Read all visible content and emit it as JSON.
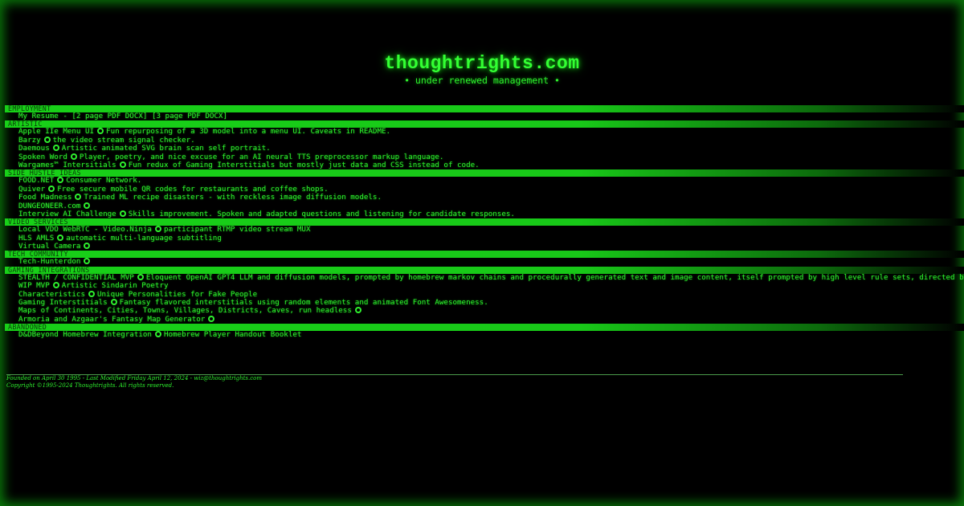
{
  "site": {
    "title": "thoughtrights.com",
    "subtitle": "• under renewed management •"
  },
  "sections": [
    {
      "title": "EMPLOYMENT",
      "items": [
        {
          "name": "My Resume - [2 page PDF DOCX] [3 page PDF DOCX]",
          "github": false,
          "desc": ""
        }
      ]
    },
    {
      "title": "ARTISTIC",
      "items": [
        {
          "name": "Apple IIe Menu UI",
          "github": true,
          "desc": "Fun repurposing of a 3D model into a menu UI. Caveats in README."
        },
        {
          "name": "Barzy",
          "github": true,
          "desc": "the video stream signal checker."
        },
        {
          "name": "Daemous",
          "github": true,
          "desc": "Artistic animated SVG brain scan self portrait."
        },
        {
          "name": "Spoken Word",
          "github": true,
          "desc": "Player, poetry, and nice excuse for an AI neural TTS preprocessor markup language."
        },
        {
          "name": "Wargames™ Intersitials",
          "github": true,
          "desc": "Fun redux of Gaming Interstitials but mostly just data and CSS instead of code."
        }
      ]
    },
    {
      "title": "SIDE HUSTLE IDEAS",
      "items": [
        {
          "name": "FOOD.NET",
          "github": true,
          "desc": "Consumer Network."
        },
        {
          "name": "Quiver",
          "github": true,
          "desc": "Free secure mobile QR codes for restaurants and coffee shops."
        },
        {
          "name": "Food Madness",
          "github": true,
          "desc": "Trained ML recipe disasters - with reckless image diffusion models."
        },
        {
          "name": "DUNGEONEER.com",
          "github": true,
          "desc": ""
        },
        {
          "name": "Interview AI Challenge",
          "github": true,
          "desc": "Skills improvement. Spoken and adapted questions and listening for candidate responses."
        }
      ]
    },
    {
      "title": "VIDEO SERVICES",
      "items": [
        {
          "name": "Local VDO WebRTC - Video.Ninja",
          "github": true,
          "desc": "participant RTMP video stream MUX"
        },
        {
          "name": "HLS AMLS",
          "github": true,
          "desc": "automatic multi-language subtitling"
        },
        {
          "name": "Virtual Camera",
          "github": true,
          "desc": ""
        }
      ]
    },
    {
      "title": "TECH COMMUNITY",
      "items": [
        {
          "name": "Tech-Hunterdon",
          "github": true,
          "desc": ""
        }
      ]
    },
    {
      "title": "GAMING INTEGRATIONS",
      "items": [
        {
          "name": "STEALTH / CONFIDENTIAL MVP",
          "github": true,
          "desc": "Eloquent OpenAI GPT4 LLM and diffusion models, prompted by homebrew markov chains and procedurally generated text and image content, itself prompted by high level rule sets, directed by consumers"
        },
        {
          "name": "WIP MVP",
          "github": true,
          "desc": "Artistic Sindarin Poetry"
        },
        {
          "name": "Characteristics",
          "github": true,
          "desc": "Unique Personalities for Fake People"
        },
        {
          "name": "Gaming Interstitials",
          "github": true,
          "desc": "Fantasy flavored interstitials using random elements and animated Font Awesomeness."
        },
        {
          "name": "Maps of Continents, Cities, Towns, Villages, Districts, Caves, run headless",
          "github": true,
          "desc": ""
        },
        {
          "name": "Armoria and Azgaar's Fantasy Map Generator",
          "github": true,
          "desc": ""
        }
      ]
    },
    {
      "title": "ABANDONED",
      "items": [
        {
          "name": "D&DBeyond Homebrew Integration",
          "github": true,
          "desc": "Homebrew Player Handout Booklet"
        }
      ]
    }
  ],
  "footer": {
    "line1": "Founded on April 30 1995 - Last Modified Friday April 12, 2024 - wiz@thoughtrights.com",
    "line2": "Copyright ©1995-2024 Thoughtrights. All rights reserved."
  },
  "colors": {
    "background": "#000000",
    "text": "#2ef02e",
    "section_bar": "#18d018",
    "section_text": "#0a3a0a",
    "title_glow": "#19c819"
  },
  "icons": {
    "github": "github-icon"
  }
}
